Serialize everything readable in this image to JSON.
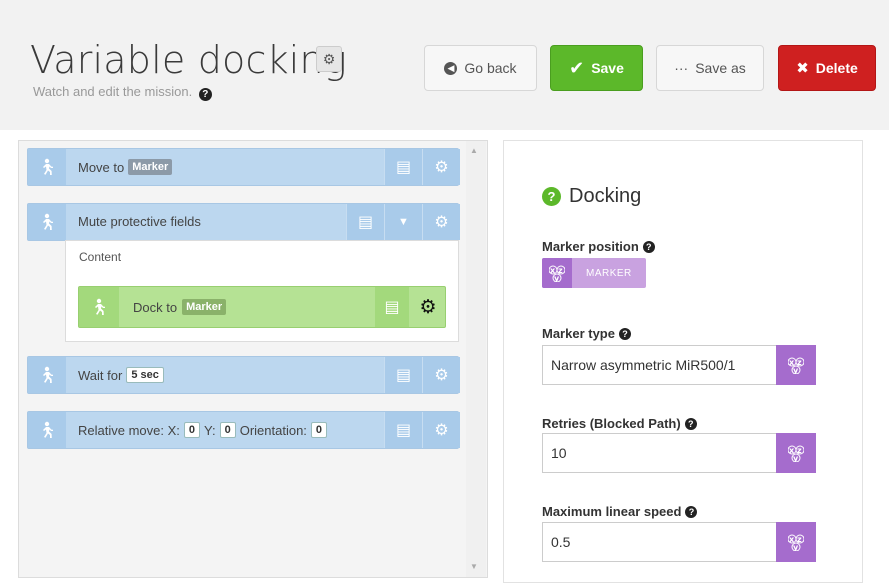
{
  "header": {
    "title": "Variable docking",
    "subtitle": "Watch and edit the mission.",
    "buttons": {
      "go_back": "Go back",
      "save": "Save",
      "save_as": "Save as",
      "delete": "Delete"
    }
  },
  "mission": {
    "rows": [
      {
        "label": "Move to",
        "param": "Marker"
      },
      {
        "label": "Mute protective fields",
        "content_label": "Content"
      },
      {
        "label": "Wait for",
        "param": "5 sec"
      },
      {
        "label": "Relative move: X:",
        "x": "0",
        "y_label": "Y:",
        "y": "0",
        "orientation_label": "Orientation:",
        "orientation": "0"
      }
    ],
    "nested": {
      "label": "Dock to",
      "param": "Marker"
    }
  },
  "settings": {
    "title": "Docking",
    "marker_position_label": "Marker position",
    "marker_button_text": "MARKER",
    "marker_type_label": "Marker type",
    "marker_type_value": "Narrow asymmetric MiR500/1",
    "retries_label": "Retries (Blocked Path)",
    "retries_value": "10",
    "max_speed_label": "Maximum linear speed",
    "max_speed_value": "0.5"
  },
  "colors": {
    "save": "#5cb82a",
    "delete": "#cf2020",
    "row_blue": "#bcd7ef",
    "row_green": "#b5e294",
    "variable_purple": "#a56ccd"
  }
}
